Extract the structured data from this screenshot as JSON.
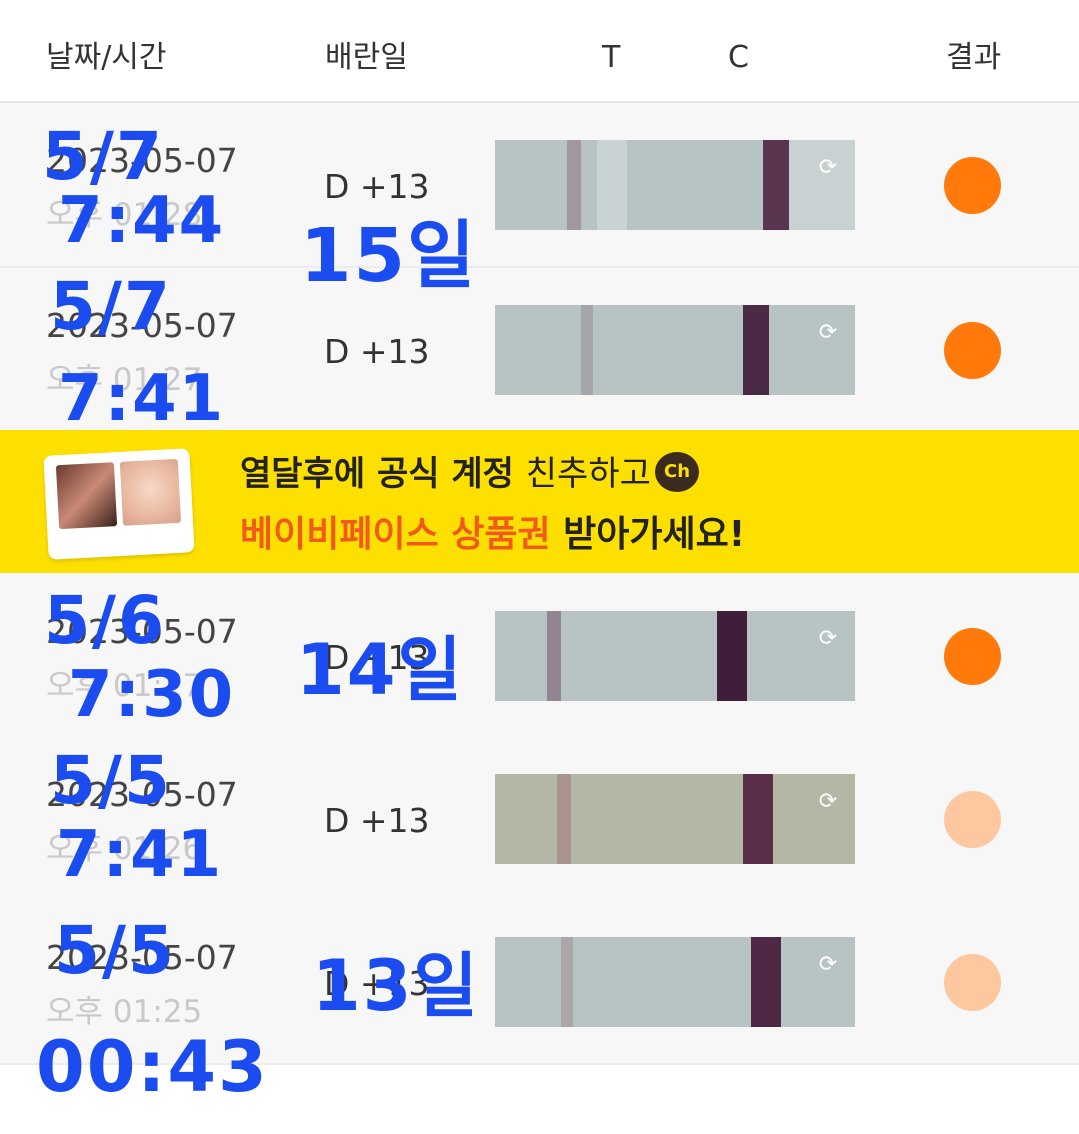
{
  "header": {
    "date_time": "날짜/시간",
    "ovulation_day": "배란일",
    "t": "T",
    "c": "C",
    "result": "결과"
  },
  "rows": [
    {
      "date": "2023-05-07",
      "time": "오후 01:28",
      "ovulation": "D +13",
      "result_color": "#ff7a0a",
      "handwritten": {
        "date": "5/7",
        "time": "7:44",
        "days": "15일"
      }
    },
    {
      "date": "2023-05-07",
      "time": "오후 01:27",
      "ovulation": "D +13",
      "result_color": "#ff7a0a",
      "handwritten": {
        "date": "5/7",
        "time": "7:41",
        "days": ""
      }
    },
    {
      "date": "2023-05-07",
      "time": "오후 01:27",
      "ovulation": "D +13",
      "result_color": "#ff7a0a",
      "handwritten": {
        "date": "5/6",
        "time": "7:30",
        "days": "14일"
      }
    },
    {
      "date": "2023-05-07",
      "time": "오후 01:26",
      "ovulation": "D +13",
      "result_color": "#fdc8a0",
      "handwritten": {
        "date": "5/5",
        "time": "7:41",
        "days": ""
      }
    },
    {
      "date": "2023-05-07",
      "time": "오후 01:25",
      "ovulation": "D +13",
      "result_color": "#fdc8a0",
      "handwritten": {
        "date": "5/5",
        "time": "00:43",
        "days": "13일"
      }
    }
  ],
  "banner": {
    "line1_bold": "열달후에 공식 계정",
    "line1_light": "친추하고",
    "channel_badge": "Ch",
    "line2_orange": "베이비페이스 상품권",
    "line2_dark": "받아가세요!"
  },
  "strip_icon": "refresh-icon"
}
